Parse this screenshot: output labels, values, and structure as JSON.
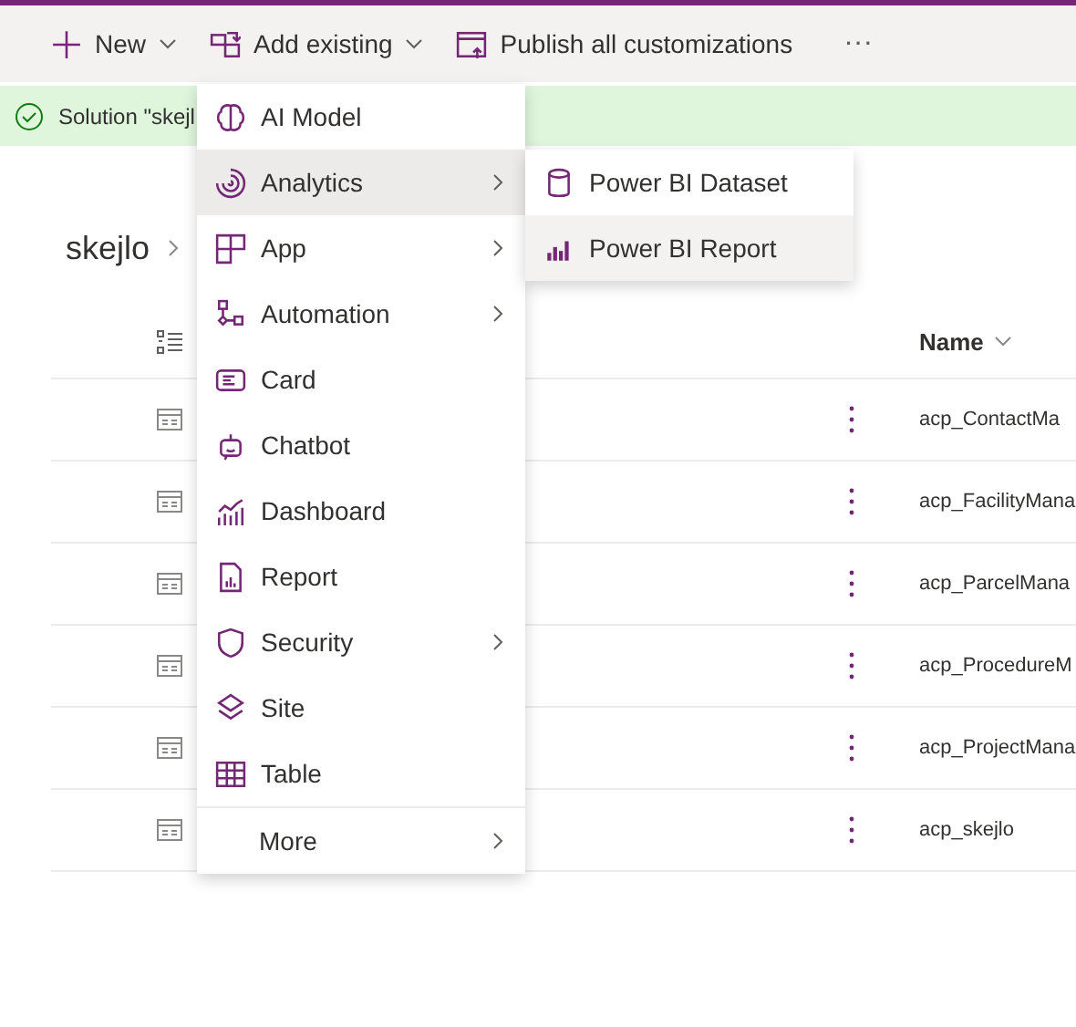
{
  "toolbar": {
    "buttons": [
      {
        "label": "New"
      },
      {
        "label": "Add existing"
      },
      {
        "label": "Publish all customizations"
      }
    ],
    "overflow": "···"
  },
  "notification": {
    "text": "Solution \"skejl"
  },
  "breadcrumb": {
    "label": "skejlo"
  },
  "table": {
    "columns": [
      {
        "label": "Name"
      }
    ],
    "rows": [
      {
        "name": "acp_ContactMa"
      },
      {
        "name": "acp_FacilityMana"
      },
      {
        "name": "acp_ParcelMana"
      },
      {
        "name": "acp_ProcedureM"
      },
      {
        "name": "acp_ProjectMana"
      },
      {
        "name": "acp_skejlo"
      }
    ]
  },
  "menu": {
    "items": [
      {
        "label": "AI Model",
        "submenu": false,
        "selected": false
      },
      {
        "label": "Analytics",
        "submenu": true,
        "selected": true
      },
      {
        "label": "App",
        "submenu": true,
        "selected": false
      },
      {
        "label": "Automation",
        "submenu": true,
        "selected": false
      },
      {
        "label": "Card",
        "submenu": false,
        "selected": false
      },
      {
        "label": "Chatbot",
        "submenu": false,
        "selected": false
      },
      {
        "label": "Dashboard",
        "submenu": false,
        "selected": false
      },
      {
        "label": "Report",
        "submenu": false,
        "selected": false
      },
      {
        "label": "Security",
        "submenu": true,
        "selected": false
      },
      {
        "label": "Site",
        "submenu": false,
        "selected": false
      },
      {
        "label": "Table",
        "submenu": false,
        "selected": false
      },
      {
        "label": "More",
        "submenu": true,
        "selected": false
      }
    ]
  },
  "submenu": {
    "items": [
      {
        "label": "Power BI Dataset",
        "selected": false
      },
      {
        "label": "Power BI Report",
        "selected": true
      }
    ]
  }
}
